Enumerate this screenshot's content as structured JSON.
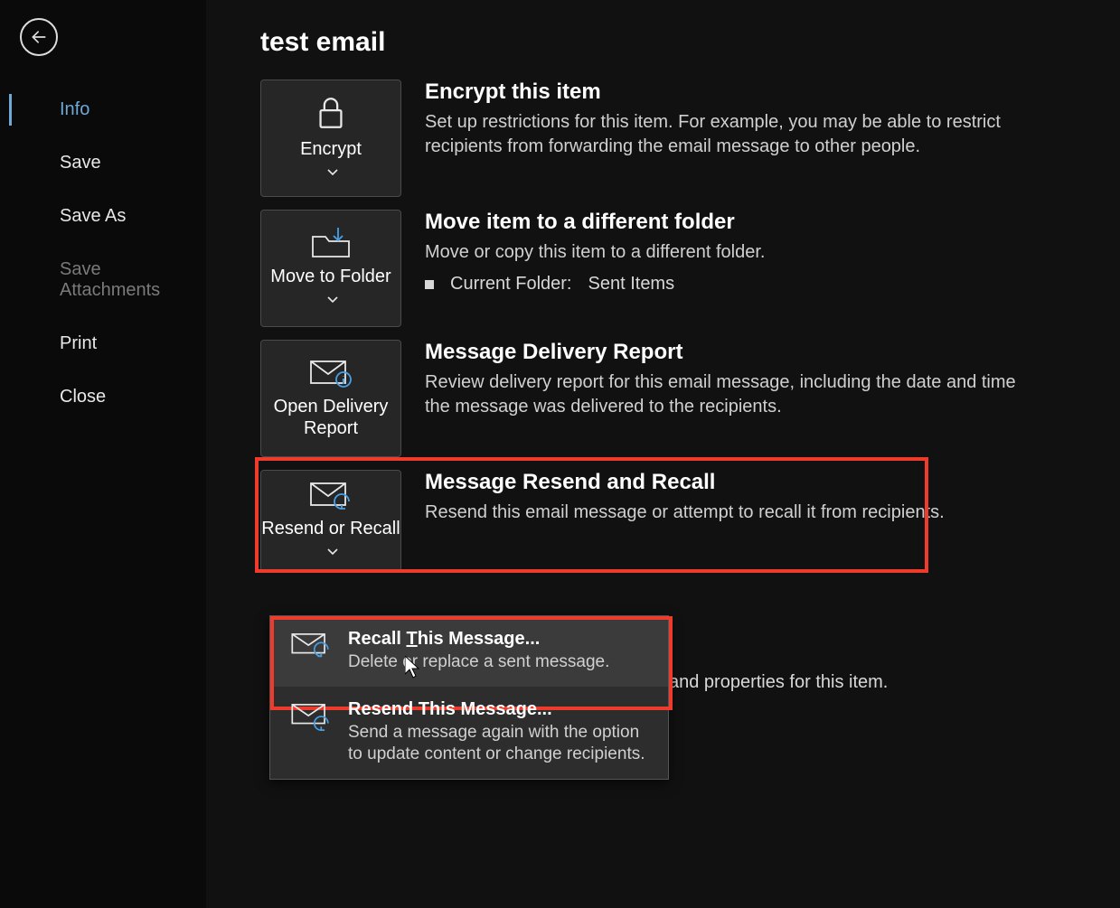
{
  "sidebar": {
    "items": [
      {
        "label": "Info",
        "selected": true,
        "disabled": false
      },
      {
        "label": "Save",
        "selected": false,
        "disabled": false
      },
      {
        "label": "Save As",
        "selected": false,
        "disabled": false
      },
      {
        "label": "Save Attachments",
        "selected": false,
        "disabled": true
      },
      {
        "label": "Print",
        "selected": false,
        "disabled": false
      },
      {
        "label": "Close",
        "selected": false,
        "disabled": false
      }
    ]
  },
  "page": {
    "title": "test email"
  },
  "sections": {
    "encrypt": {
      "tile_label": "Encrypt",
      "heading": "Encrypt this item",
      "desc": "Set up restrictions for this item. For example, you may be able to restrict recipients from forwarding the email message to other people."
    },
    "move": {
      "tile_label": "Move to Folder",
      "heading": "Move item to a different folder",
      "desc": "Move or copy this item to a different folder.",
      "current_label": "Current Folder:",
      "current_value": "Sent Items"
    },
    "delivery": {
      "tile_label": "Open Delivery Report",
      "heading": "Message Delivery Report",
      "desc": "Review delivery report for this email message, including the date and time the message was delivered to the recipients."
    },
    "resend": {
      "tile_label": "Resend or Recall",
      "heading": "Message Resend and Recall",
      "desc": "Resend this email message or attempt to recall it from recipients."
    },
    "properties": {
      "desc_fragment": "and properties for this item."
    }
  },
  "menu": {
    "recall": {
      "title_pre": "Recall ",
      "title_accel": "T",
      "title_post": "his Message...",
      "desc": "Delete or replace a sent message."
    },
    "resend": {
      "title": "Resend This Message...",
      "desc": "Send a message again with the option to update content or change recipients."
    }
  }
}
